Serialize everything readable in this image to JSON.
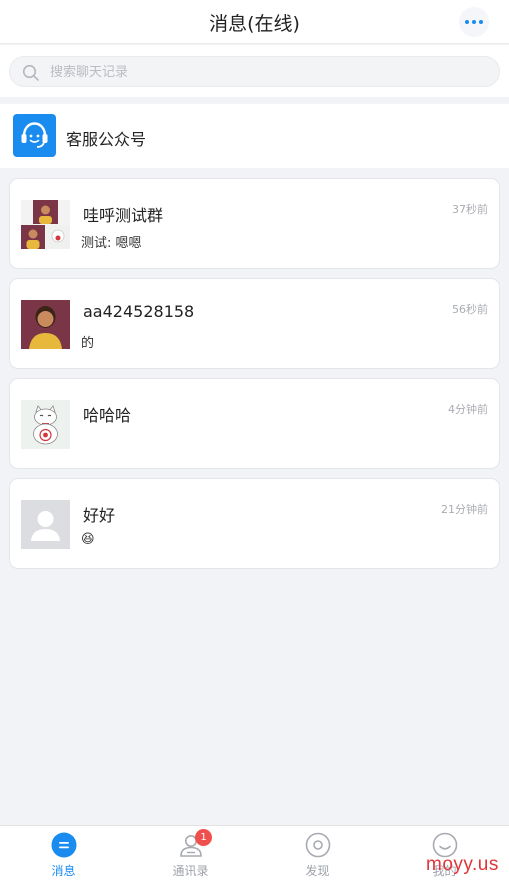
{
  "header": {
    "title": "消息(在线)",
    "more_icon": "more-dots-icon"
  },
  "search": {
    "placeholder": "搜索聊天记录"
  },
  "service": {
    "label": "客服公众号"
  },
  "conversations": [
    {
      "name": "哇呼测试群",
      "preview": "测试: 嗯嗯",
      "time": "37秒前"
    },
    {
      "name": "aa424528158",
      "preview": "的",
      "time": "56秒前"
    },
    {
      "name": "哈哈哈",
      "preview": "",
      "time": "4分钟前"
    },
    {
      "name": "好好",
      "preview": "😆",
      "time": "21分钟前"
    }
  ],
  "tabs": [
    {
      "label": "消息",
      "active": true
    },
    {
      "label": "通讯录",
      "badge": "1"
    },
    {
      "label": "发现"
    },
    {
      "label": "我的"
    }
  ],
  "watermark": "moyy.us",
  "colors": {
    "accent": "#1a8cf0",
    "badge": "#f0504d"
  }
}
